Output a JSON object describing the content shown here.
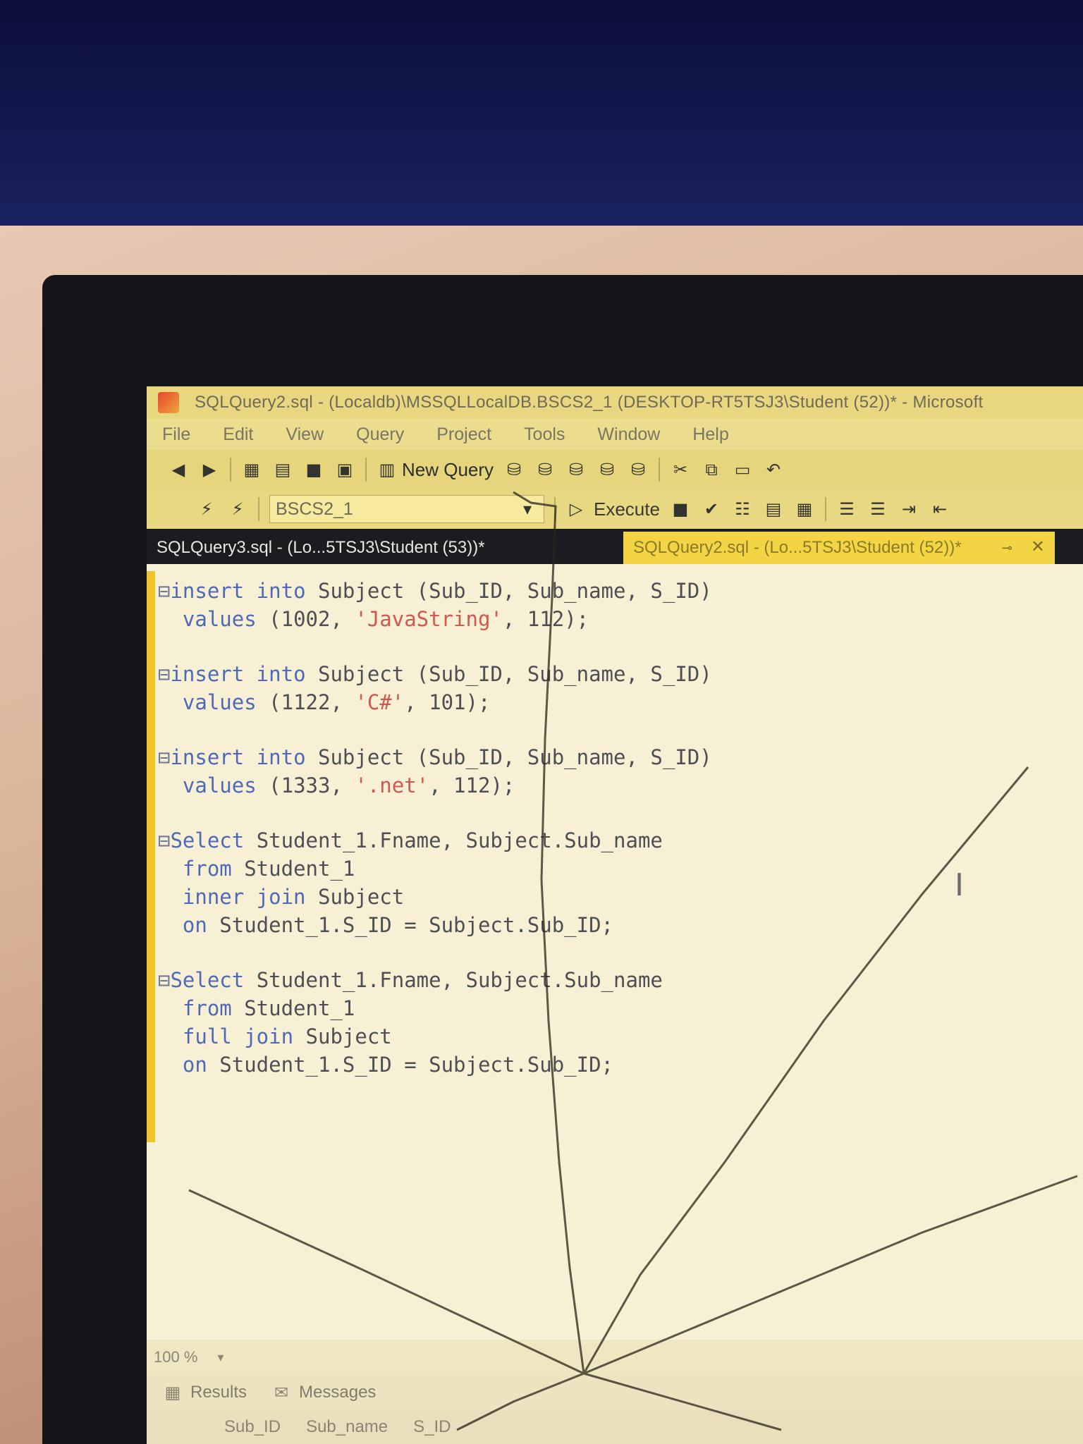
{
  "window": {
    "title": "SQLQuery2.sql - (Localdb)\\MSSQLLocalDB.BSCS2_1 (DESKTOP-RT5TSJ3\\Student (52))* - Microsoft"
  },
  "menu": [
    "File",
    "Edit",
    "View",
    "Query",
    "Project",
    "Tools",
    "Window",
    "Help"
  ],
  "toolbar": {
    "new_query_label": "New Query",
    "database": "BSCS2_1",
    "execute_label": "Execute"
  },
  "tabs": [
    {
      "label": "SQLQuery3.sql - (Lo...5TSJ3\\Student (53))*",
      "active": false
    },
    {
      "label": "SQLQuery2.sql - (Lo...5TSJ3\\Student (52))*",
      "active": true
    }
  ],
  "code": {
    "block1": {
      "line1": {
        "kw1": "insert into",
        "rest": " Subject (Sub_ID, Sub_name, S_ID)"
      },
      "line2": {
        "kw": "values",
        "pre": " (1002, ",
        "str": "'JavaString'",
        "post": ", 112);"
      }
    },
    "block2": {
      "line1": {
        "kw1": "insert into",
        "rest": " Subject (Sub_ID, Sub_name, S_ID)"
      },
      "line2": {
        "kw": "values",
        "pre": " (1122, ",
        "str": "'C#'",
        "post": ", 101);"
      }
    },
    "block3": {
      "line1": {
        "kw1": "insert into",
        "rest": " Subject (Sub_ID, Sub_name, S_ID)"
      },
      "line2": {
        "kw": "values",
        "pre": " (1333, ",
        "str": "'.net'",
        "post": ", 112);"
      }
    },
    "block4": {
      "line1": {
        "kw": "Select",
        "rest": " Student_1.Fname, Subject.Sub_name"
      },
      "line2": {
        "kw": "from",
        "rest": " Student_1"
      },
      "line3": {
        "kw": "inner join",
        "rest": " Subject"
      },
      "line4": {
        "kw": "on",
        "rest": " Student_1.S_ID = Subject.Sub_ID;"
      }
    },
    "block5": {
      "line1": {
        "kw": "Select",
        "rest": " Student_1.Fname, Subject.Sub_name"
      },
      "line2": {
        "kw": "from",
        "rest": " Student_1"
      },
      "line3": {
        "kw": "full join",
        "rest": " Subject"
      },
      "line4": {
        "kw": "on",
        "rest": " Student_1.S_ID = Subject.Sub_ID;"
      }
    }
  },
  "status": {
    "zoom": "100 %"
  },
  "results_tabs": [
    "Results",
    "Messages"
  ],
  "results_columns": [
    "Sub_ID",
    "Sub_name",
    "S_ID"
  ],
  "colors": {
    "accent_tab": "#f2d445",
    "keyword": "#4d69b8",
    "string": "#d0584e"
  }
}
